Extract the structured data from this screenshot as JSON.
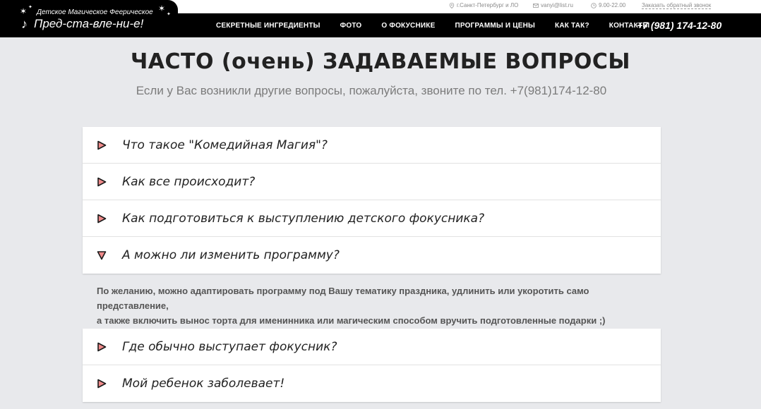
{
  "topbar": {
    "location": "г.Санкт-Петербург и ЛО",
    "email": "vanyi@list.ru",
    "hours": "9.00-22.00",
    "callback": "Заказать обратный звонок"
  },
  "logo": {
    "line1": "Детское Магическое Феерическое",
    "line2": "Пред-ста-вле-ни-е!"
  },
  "nav": {
    "items": [
      {
        "label": "СЕКРЕТНЫЕ ИНГРЕДИЕНТЫ"
      },
      {
        "label": "ФОТО"
      },
      {
        "label": "О ФОКУСНИКЕ"
      },
      {
        "label": "ПРОГРАММЫ И ЦЕНЫ"
      },
      {
        "label": "КАК ТАК?"
      },
      {
        "label": "КОНТАКТЫ"
      }
    ],
    "phone": "+7 (981) 174-12-80"
  },
  "page": {
    "title": "ЧАСТО (очень) ЗАДАВАЕМЫЕ ВОПРОСЫ",
    "subtitle": "Если у Вас возникли другие вопросы, пожалуйста, звоните по тел. +7(981)174-12-80"
  },
  "faq": {
    "group1": [
      {
        "question": "Что такое \"Комедийная Магия\"?",
        "expanded": false
      },
      {
        "question": "Как все происходит?",
        "expanded": false
      },
      {
        "question": "Как подготовиться к выступлению детского фокусника?",
        "expanded": false
      },
      {
        "question": "А можно ли изменить программу?",
        "expanded": true
      }
    ],
    "answer_line1": "По желанию,  можно адаптировать программу под Вашу тематику праздника, удлинить или укоротить само представление,",
    "answer_line2": "а также включить вынос торта для именинника или магическим способом вручить  подготовленные подарки ;)",
    "group2": [
      {
        "question": "Где обычно выступает фокусник?",
        "expanded": false
      },
      {
        "question": "Мой ребенок заболевает!",
        "expanded": false
      }
    ]
  },
  "colors": {
    "triangle_fill": "#f08a8a",
    "triangle_stroke": "#1a1a1a",
    "nav_bg": "#000000",
    "page_bg": "#e8e9ec"
  }
}
